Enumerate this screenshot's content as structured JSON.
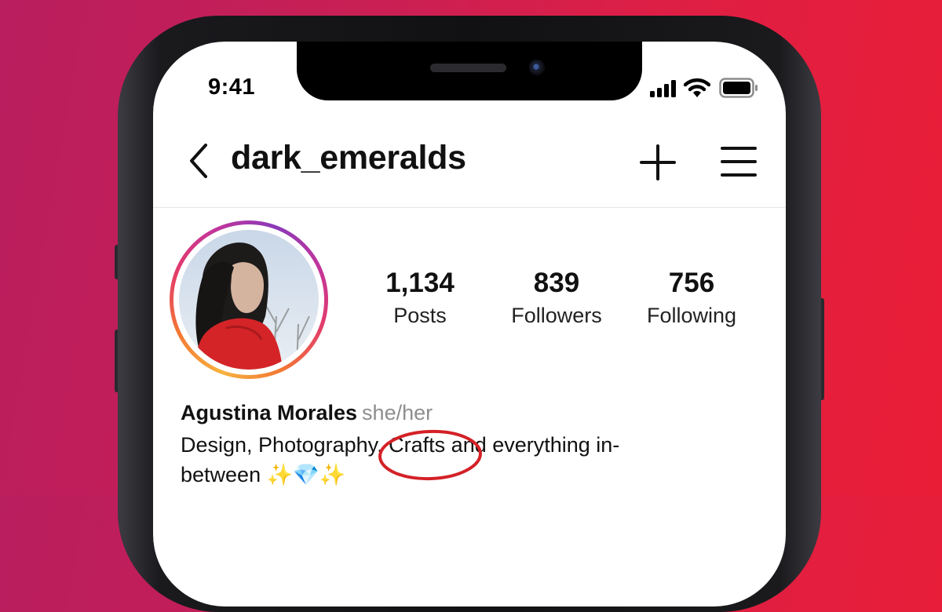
{
  "status_bar": {
    "time": "9:41"
  },
  "header": {
    "username": "dark_emeralds"
  },
  "stats": [
    {
      "value": "1,134",
      "label": "Posts"
    },
    {
      "value": "839",
      "label": "Followers"
    },
    {
      "value": "756",
      "label": "Following"
    }
  ],
  "bio": {
    "name": "Agustina Morales",
    "pronouns": "she/her",
    "text": "Design, Photography, Crafts and everything in-between ✨💎✨"
  },
  "icons": {
    "back": "back-chevron-icon",
    "add": "plus-icon",
    "menu": "hamburger-menu-icon",
    "signal": "cellular-signal-icon",
    "wifi": "wifi-icon",
    "battery": "battery-icon"
  },
  "colors": {
    "background_left": "#b91e5e",
    "background_right": "#ea1d36",
    "annotation_circle": "#d42127",
    "pronouns_text": "#8e8e8e"
  }
}
